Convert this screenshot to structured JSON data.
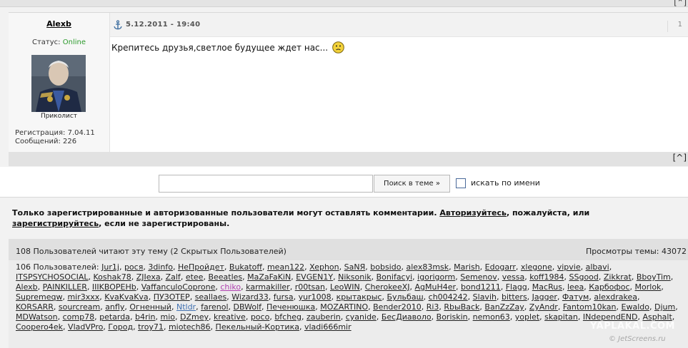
{
  "top": {
    "corner_button": "[⌃]"
  },
  "post": {
    "author": "Alexb",
    "status_label": "Статус:",
    "status_value": "Online",
    "rank": "Приколист",
    "registration": "Регистрация: 7.04.11",
    "messages": "Сообщений: 226",
    "date": "5.12.2011 - 19:40",
    "number": "1",
    "text": "Крепитесь друзья,светлое будущее ждет нас...",
    "up_button": "[^]"
  },
  "search": {
    "input_value": "",
    "button_label": "Поиск   в теме »",
    "checkbox_label": "искать по имени"
  },
  "notice": {
    "part1": "Только зарегистрированные и авторизованные пользователи могут оставлять комментарии.",
    "login_link": "Авторизуйтесь",
    "part2": ", пожалуйста, или",
    "register_link": "зарегистрируйтесь",
    "part3": ", если не зарегистрированы."
  },
  "readers": {
    "header": "108 Пользователей читают эту тему (2 Скрытых Пользователей)",
    "views": "Просмотры темы: 43072",
    "prefix": "106 Пользователей:",
    "users": [
      {
        "n": "Jur1j"
      },
      {
        "n": "рося"
      },
      {
        "n": "3dinfo"
      },
      {
        "n": "НеПройдет"
      },
      {
        "n": "Bukatoff"
      },
      {
        "n": "mean122"
      },
      {
        "n": "Xephon"
      },
      {
        "n": "SaNЯ"
      },
      {
        "n": "bobsido"
      },
      {
        "n": "alex83msk"
      },
      {
        "n": "Marish"
      },
      {
        "n": "Edogarr"
      },
      {
        "n": "xlegone"
      },
      {
        "n": "vipvie"
      },
      {
        "n": "albavi"
      },
      {
        "n": "ITSPSYCHOSOCIAL"
      },
      {
        "n": "Koshak78"
      },
      {
        "n": "ZJIexa"
      },
      {
        "n": "Zalf"
      },
      {
        "n": "etee"
      },
      {
        "n": "Beeatles"
      },
      {
        "n": "MaZaFaKiN"
      },
      {
        "n": "EVGEN1Y"
      },
      {
        "n": "Niksonik"
      },
      {
        "n": "Bonifacyi"
      },
      {
        "n": "igorigorm"
      },
      {
        "n": "Semenov"
      },
      {
        "n": "vessa"
      },
      {
        "n": "koff1984"
      },
      {
        "n": "SSgood"
      },
      {
        "n": "Zikkrat"
      },
      {
        "n": "BboyTim"
      },
      {
        "n": "Alexb"
      },
      {
        "n": "PAINKILLER"
      },
      {
        "n": "IIIKBOPEHb"
      },
      {
        "n": "VaffanculoCoprone"
      },
      {
        "n": "chiko",
        "c": "vip"
      },
      {
        "n": "karmakiller"
      },
      {
        "n": "r00tsan"
      },
      {
        "n": "LeoWIN"
      },
      {
        "n": "CherokeeXJ"
      },
      {
        "n": "AgMuH4er"
      },
      {
        "n": "bond1211"
      },
      {
        "n": "Flagg"
      },
      {
        "n": "MacRus"
      },
      {
        "n": "leea"
      },
      {
        "n": "Карбофос"
      },
      {
        "n": "Morlok"
      },
      {
        "n": "Supremeqw"
      },
      {
        "n": "mir3xxx"
      },
      {
        "n": "KvaKvaKva"
      },
      {
        "n": "ПУЗОТЕР"
      },
      {
        "n": "seallaes"
      },
      {
        "n": "Wizard33"
      },
      {
        "n": "fursa"
      },
      {
        "n": "yur1008"
      },
      {
        "n": "крытакрыс"
      },
      {
        "n": "Бульбаш"
      },
      {
        "n": "ch004242"
      },
      {
        "n": "Slavih"
      },
      {
        "n": "bitters"
      },
      {
        "n": "Jagger"
      },
      {
        "n": "Фатум"
      },
      {
        "n": "alexdrakea"
      },
      {
        "n": "KORSARR"
      },
      {
        "n": "sourcream"
      },
      {
        "n": "anfly"
      },
      {
        "n": "Огненный"
      },
      {
        "n": "Ntldr",
        "c": "blue"
      },
      {
        "n": "farenol"
      },
      {
        "n": "DBWolf"
      },
      {
        "n": "Печенюшка"
      },
      {
        "n": "MOZARTINO"
      },
      {
        "n": "Bender2010"
      },
      {
        "n": "Ri3"
      },
      {
        "n": "RbыBack"
      },
      {
        "n": "BanZzZay"
      },
      {
        "n": "ZyAndr"
      },
      {
        "n": "Fantom10kan"
      },
      {
        "n": "Ewaldo"
      },
      {
        "n": "Djum"
      },
      {
        "n": "MDWatson"
      },
      {
        "n": "comp78"
      },
      {
        "n": "petarda"
      },
      {
        "n": "b4rin"
      },
      {
        "n": "mio"
      },
      {
        "n": "DZmey"
      },
      {
        "n": "kreative"
      },
      {
        "n": "poco"
      },
      {
        "n": "bfcheg"
      },
      {
        "n": "zauberin"
      },
      {
        "n": "cyanide"
      },
      {
        "n": "БесДиаволо"
      },
      {
        "n": "Boriskin"
      },
      {
        "n": "nemon63"
      },
      {
        "n": "yoplet"
      },
      {
        "n": "skapitan"
      },
      {
        "n": "INdependEND"
      },
      {
        "n": "Asphalt"
      },
      {
        "n": "Coopero4ek"
      },
      {
        "n": "VladVPro"
      },
      {
        "n": "Город"
      },
      {
        "n": "troy71"
      },
      {
        "n": "miotech86"
      },
      {
        "n": "Пекельный-Кортика"
      },
      {
        "n": "vladi666mir"
      }
    ]
  },
  "watermark": {
    "brand": "YAPLAKAL.COM",
    "source": "© JetScreens.ru"
  }
}
